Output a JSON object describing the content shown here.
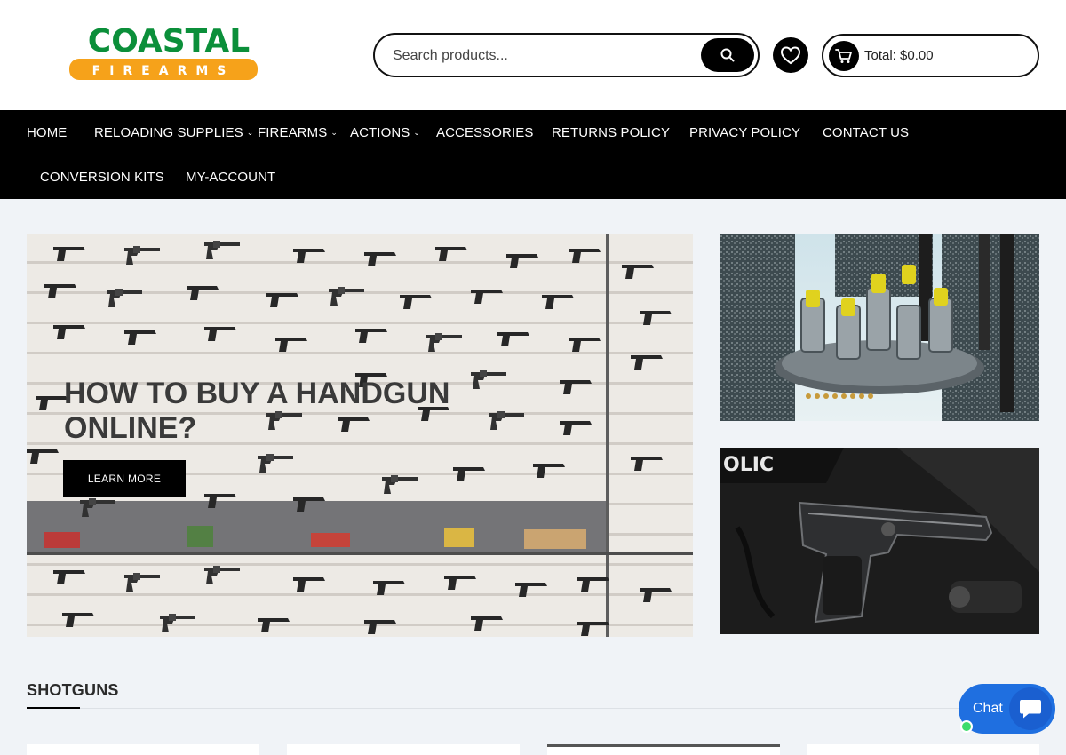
{
  "brand": {
    "name": "COASTAL",
    "subname": "FIREARMS",
    "green": "#0b8f3a",
    "orange": "#f6a21a"
  },
  "search": {
    "placeholder": "Search products..."
  },
  "cart": {
    "total": "Total: $0.00"
  },
  "nav": {
    "items": [
      {
        "label": "HOME",
        "has_dropdown": false
      },
      {
        "label": "RELOADING SUPPLIES",
        "has_dropdown": true
      },
      {
        "label": "FIREARMS",
        "has_dropdown": true
      },
      {
        "label": "ACTIONS",
        "has_dropdown": true
      },
      {
        "label": "ACCESSORIES",
        "has_dropdown": false
      },
      {
        "label": "RETURNS POLICY",
        "has_dropdown": false
      },
      {
        "label": "PRIVACY POLICY",
        "has_dropdown": false
      },
      {
        "label": "CONTACT US",
        "has_dropdown": false
      },
      {
        "label": "CONVERSION KITS",
        "has_dropdown": false
      },
      {
        "label": "MY-ACCOUNT",
        "has_dropdown": false
      }
    ]
  },
  "hero": {
    "title": "HOW TO BUY A HANDGUN ONLINE?",
    "button": "LEARN MORE"
  },
  "section": {
    "title": "SHOTGUNS"
  },
  "chat": {
    "label": "Chat"
  },
  "icons": {
    "search": "search-icon",
    "wishlist": "heart-icon",
    "cart": "cart-icon",
    "chevron": "chevron-down-icon",
    "chat": "chat-bubble-icon"
  }
}
